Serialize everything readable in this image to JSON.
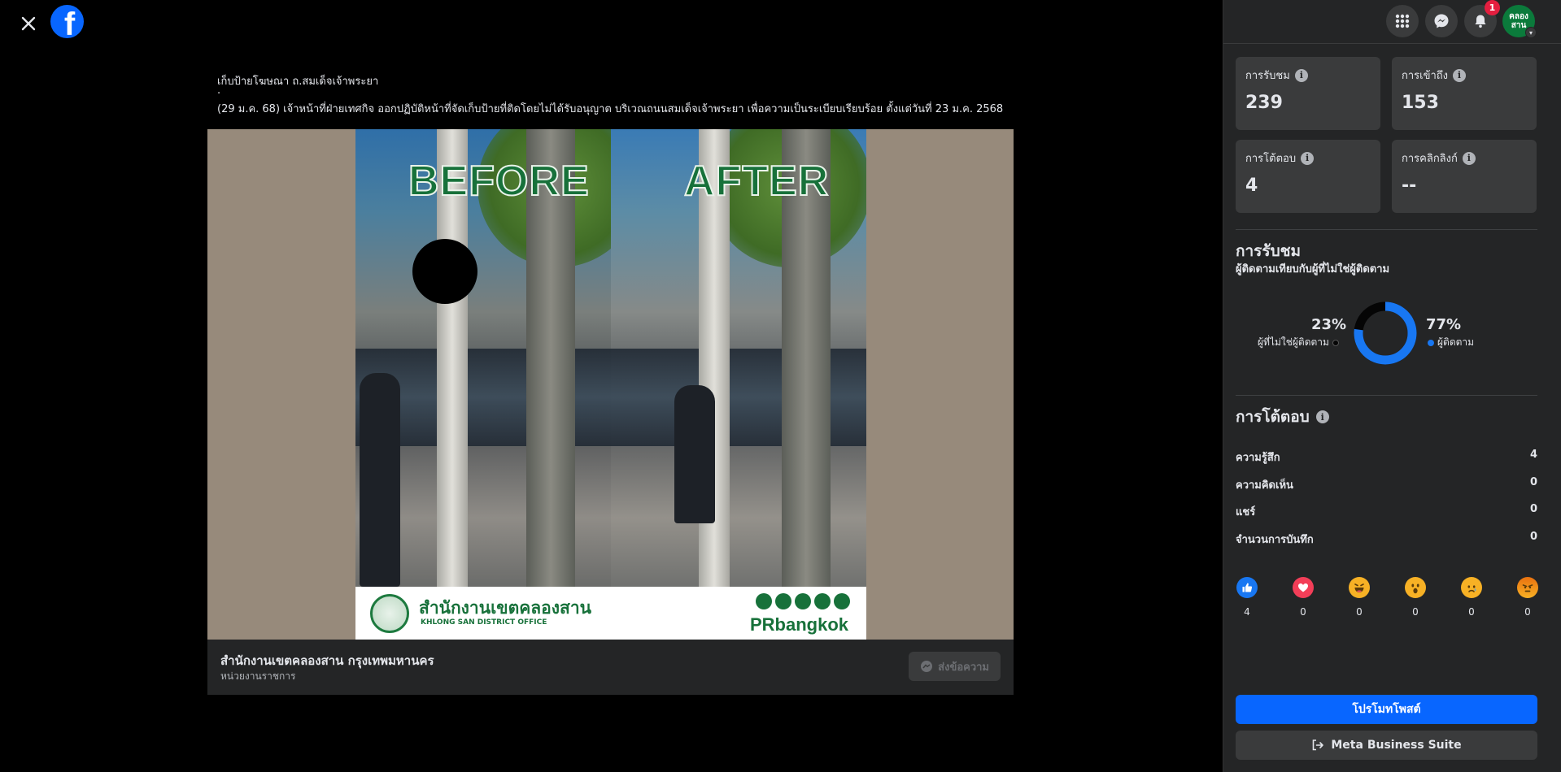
{
  "post": {
    "caption_title": "เก็บป้ายโฆษณา ถ.สมเด็จเจ้าพระยา",
    "caption_dot": ".",
    "caption_body": "(29 ม.ค. 68) เจ้าหน้าที่ฝ่ายเทศกิจ ออกปฏิบัติหน้าที่จัดเก็บป้ายที่ติดโดยไม่ได้รับอนุญาต บริเวณถนนสมเด็จเจ้าพระยา เพื่อความเป็นระเบียบเรียบร้อย ตั้งแต่วันที่ 23 ม.ค. 2568"
  },
  "image": {
    "before_label": "BEFORE",
    "after_label": "AFTER",
    "office_th": "สำนักงานเขตคลองสาน",
    "office_en": "KHLONG SAN DISTRICT OFFICE",
    "brand": "PRbangkok"
  },
  "page": {
    "name": "สำนักงานเขตคลองสาน กรุงเทพมหานคร",
    "category": "หน่วยงานราชการ",
    "message_button": "ส่งข้อความ"
  },
  "topbar": {
    "notification_count": "1",
    "avatar_text_1": "คลอง",
    "avatar_text_2": "สาน"
  },
  "stats": [
    {
      "label": "การรับชม",
      "value": "239"
    },
    {
      "label": "การเข้าถึง",
      "value": "153"
    },
    {
      "label": "การโต้ตอบ",
      "value": "4"
    },
    {
      "label": "การคลิกลิงก์",
      "value": "--"
    }
  ],
  "views": {
    "title": "การรับชม",
    "subtitle": "ผู้ติดตามเทียบกับผู้ที่ไม่ใช่ผู้ติดตาม",
    "non_followers_pct": "23%",
    "non_followers_label": "ผู้ที่ไม่ใช่ผู้ติดตาม",
    "followers_pct": "77%",
    "followers_label": "ผู้ติดตาม",
    "followers_fraction": 0.77,
    "colors": {
      "followers": "#1877f2",
      "non_followers": "#050505"
    }
  },
  "interactions": {
    "title": "การโต้ตอบ",
    "rows": [
      {
        "label": "ความรู้สึก",
        "value": "4"
      },
      {
        "label": "ความคิดเห็น",
        "value": "0"
      },
      {
        "label": "แชร์",
        "value": "0"
      },
      {
        "label": "จำนวนการบันทึก",
        "value": "0"
      }
    ],
    "reactions": [
      {
        "icon": "like-icon",
        "count": "4"
      },
      {
        "icon": "love-icon",
        "count": "0"
      },
      {
        "icon": "haha-icon",
        "count": "0"
      },
      {
        "icon": "wow-icon",
        "count": "0"
      },
      {
        "icon": "sad-icon",
        "count": "0"
      },
      {
        "icon": "angry-icon",
        "count": "0"
      }
    ]
  },
  "actions": {
    "promote": "โปรโมทโพสต์",
    "business_suite": "Meta Business Suite"
  }
}
